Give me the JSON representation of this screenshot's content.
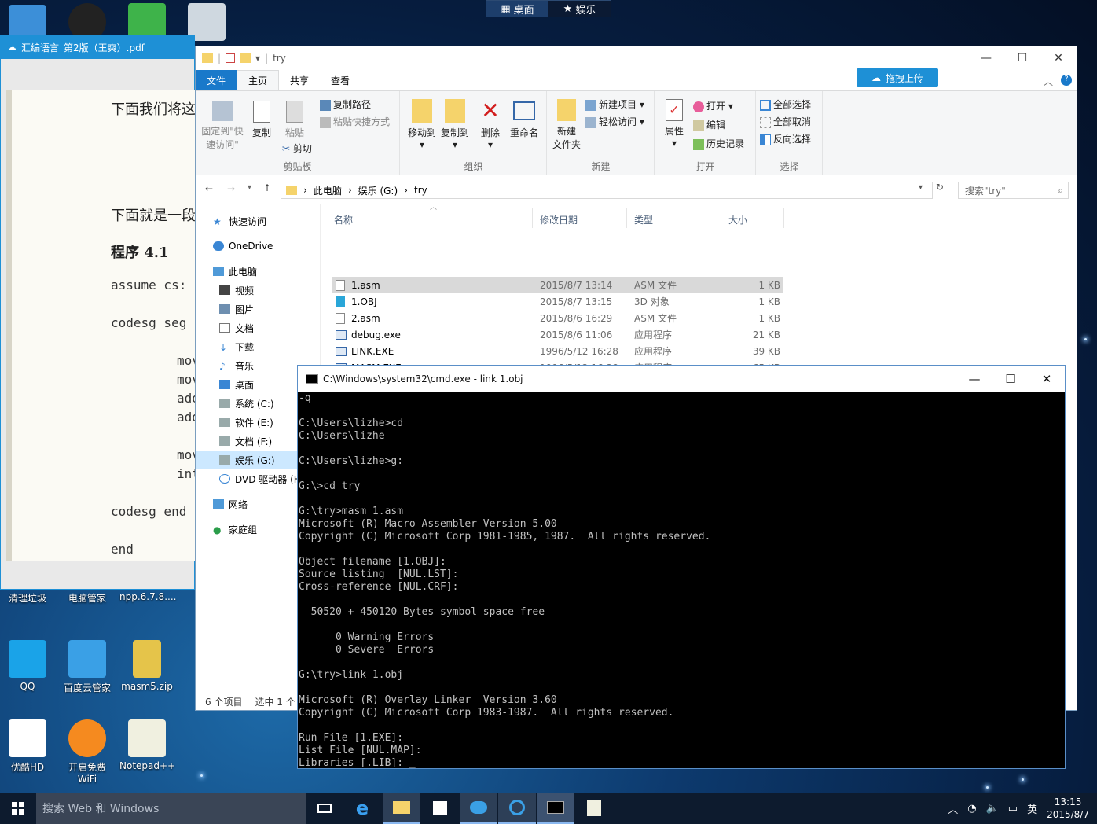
{
  "desktop_tabs": [
    {
      "label": "桌面",
      "active": true
    },
    {
      "label": "娱乐",
      "active": false
    }
  ],
  "desktop_icons": [
    {
      "label": "清理垃圾",
      "color": "#2b8ad6"
    },
    {
      "label": "电脑管家",
      "color": "#1f6fd8"
    },
    {
      "label": "npp.6.7.8....",
      "color": "#d8a23a"
    },
    {
      "label": "QQ",
      "color": "#1aa3e8"
    },
    {
      "label": "百度云管家",
      "color": "#3aa0e6"
    },
    {
      "label": "masm5.zip",
      "color": "#e5c44a"
    },
    {
      "label": "优酷HD",
      "color": "#ffffff"
    },
    {
      "label": "开启免费WiFi",
      "color": "#f58a1f"
    },
    {
      "label": "Notepad++",
      "color": "#f0f0e0"
    }
  ],
  "pdf": {
    "title": "汇编语言_第2版（王爽）.pdf",
    "lines": [
      "下面我们将这",
      "下面就是一段",
      "程序 4.1",
      "assume cs:",
      "codesg seg",
      "mov",
      "mov",
      "add",
      "add",
      "mov",
      "int",
      "codesg end",
      "end"
    ]
  },
  "explorer": {
    "title": "try",
    "window_controls": [
      "—",
      "☐",
      "✕"
    ],
    "tabs": [
      "文件",
      "主页",
      "共享",
      "查看"
    ],
    "upload_label": "拖拽上传",
    "ribbon": {
      "clipboard": {
        "label": "剪贴板",
        "pin": "固定到\"快\n速访问\"",
        "copy": "复制",
        "paste": "粘贴",
        "copy_path": "复制路径",
        "paste_shortcut": "粘贴快捷方式",
        "cut": "剪切"
      },
      "organize": {
        "label": "组织",
        "move_to": "移动到",
        "copy_to": "复制到",
        "delete": "删除",
        "rename": "重命名"
      },
      "new": {
        "label": "新建",
        "new_folder": "新建\n文件夹",
        "new_item": "新建项目 ▾",
        "easy_access": "轻松访问 ▾"
      },
      "open": {
        "label": "打开",
        "properties": "属性",
        "open": "打开 ▾",
        "edit": "编辑",
        "history": "历史记录"
      },
      "select": {
        "label": "选择",
        "select_all": "全部选择",
        "select_none": "全部取消",
        "invert": "反向选择"
      }
    },
    "breadcrumb": [
      "此电脑",
      "娱乐 (G:)",
      "try"
    ],
    "search_placeholder": "搜索\"try\"",
    "nav": [
      {
        "label": "快速访问",
        "indent": 0
      },
      {
        "label": "OneDrive",
        "indent": 0
      },
      {
        "label": "此电脑",
        "indent": 0
      },
      {
        "label": "视频",
        "indent": 1
      },
      {
        "label": "图片",
        "indent": 1
      },
      {
        "label": "文档",
        "indent": 1
      },
      {
        "label": "下载",
        "indent": 1
      },
      {
        "label": "音乐",
        "indent": 1
      },
      {
        "label": "桌面",
        "indent": 1
      },
      {
        "label": "系统 (C:)",
        "indent": 1
      },
      {
        "label": "软件 (E:)",
        "indent": 1
      },
      {
        "label": "文档 (F:)",
        "indent": 1
      },
      {
        "label": "娱乐 (G:)",
        "indent": 1,
        "selected": true
      },
      {
        "label": "DVD 驱动器 (H",
        "indent": 1
      },
      {
        "label": "网络",
        "indent": 0
      },
      {
        "label": "家庭组",
        "indent": 0
      }
    ],
    "columns": [
      "名称",
      "修改日期",
      "类型",
      "大小"
    ],
    "files": [
      {
        "name": "1.asm",
        "date": "2015/8/7 13:14",
        "type": "ASM 文件",
        "size": "1 KB",
        "selected": true
      },
      {
        "name": "1.OBJ",
        "date": "2015/8/7 13:15",
        "type": "3D 对象",
        "size": "1 KB"
      },
      {
        "name": "2.asm",
        "date": "2015/8/6 16:29",
        "type": "ASM 文件",
        "size": "1 KB"
      },
      {
        "name": "debug.exe",
        "date": "2015/8/6 11:06",
        "type": "应用程序",
        "size": "21 KB"
      },
      {
        "name": "LINK.EXE",
        "date": "1996/5/12 16:28",
        "type": "应用程序",
        "size": "39 KB"
      },
      {
        "name": "MASM.EXE",
        "date": "1996/5/12 16:28",
        "type": "应用程序",
        "size": "65 KB"
      }
    ],
    "status": [
      "6 个项目",
      "选中 1 个"
    ]
  },
  "cmd": {
    "title": "C:\\Windows\\system32\\cmd.exe - link  1.obj",
    "window_controls": [
      "—",
      "☐",
      "✕"
    ],
    "output": "-q\n\nC:\\Users\\lizhe>cd\nC:\\Users\\lizhe\n\nC:\\Users\\lizhe>g:\n\nG:\\>cd try\n\nG:\\try>masm 1.asm\nMicrosoft (R) Macro Assembler Version 5.00\nCopyright (C) Microsoft Corp 1981-1985, 1987.  All rights reserved.\n\nObject filename [1.OBJ]:\nSource listing  [NUL.LST]:\nCross-reference [NUL.CRF]:\n\n  50520 + 450120 Bytes symbol space free\n\n      0 Warning Errors\n      0 Severe  Errors\n\nG:\\try>link 1.obj\n\nMicrosoft (R) Overlay Linker  Version 3.60\nCopyright (C) Microsoft Corp 1983-1987.  All rights reserved.\n\nRun File [1.EXE]:\nList File [NUL.MAP]:\nLibraries [.LIB]: _"
  },
  "taskbar": {
    "search_placeholder": "搜索 Web 和 Windows",
    "apps": [
      "task-view",
      "edge",
      "file-explorer",
      "store",
      "baidu-cloud",
      "qq-browser",
      "cmd",
      "notepad"
    ],
    "tray": {
      "lang": "英",
      "time": "13:15",
      "date": "2015/8/7"
    }
  }
}
